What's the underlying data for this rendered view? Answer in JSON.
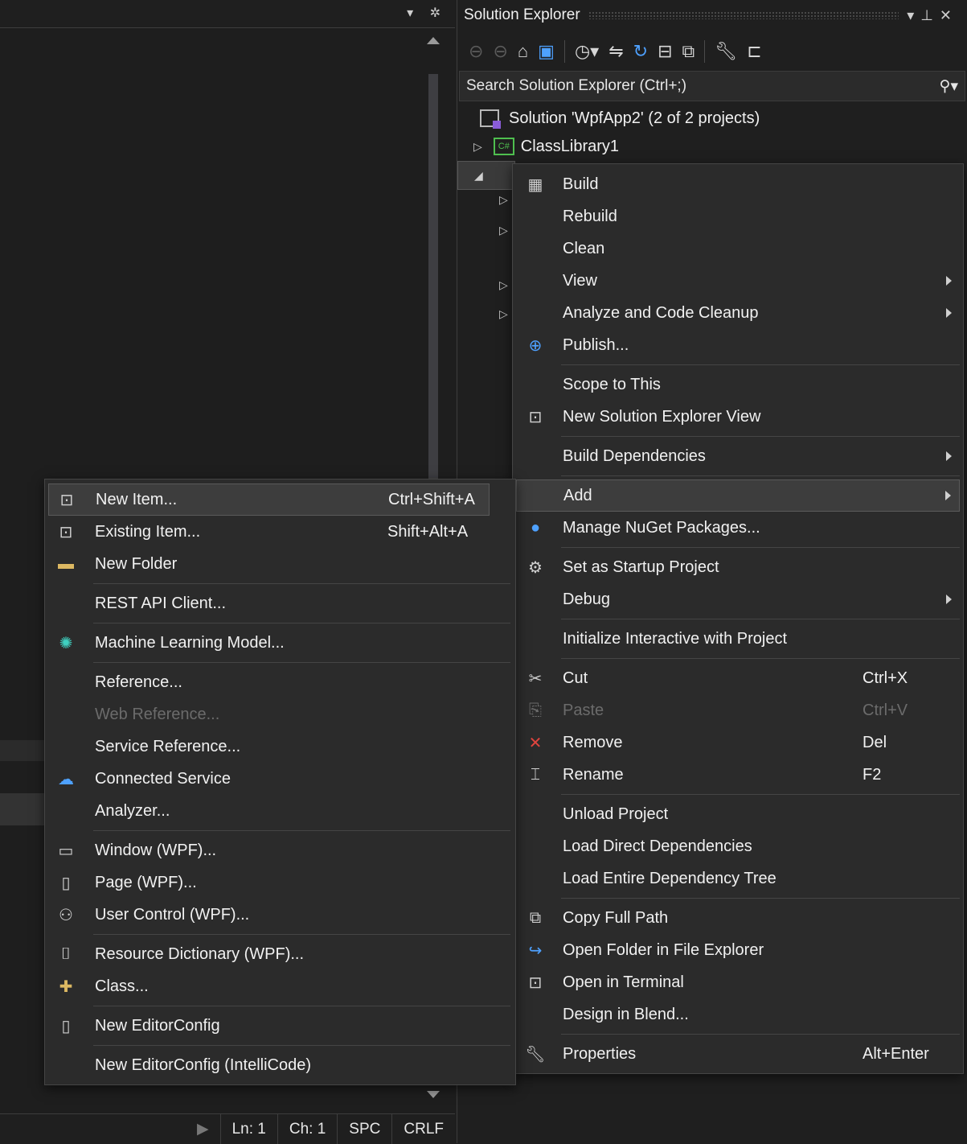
{
  "editor": {
    "status": {
      "line": "Ln: 1",
      "col": "Ch: 1",
      "indent": "SPC",
      "eol": "CRLF"
    }
  },
  "solution_explorer": {
    "title": "Solution Explorer",
    "search_placeholder": "Search Solution Explorer (Ctrl+;)",
    "solution_label": "Solution 'WpfApp2' (2 of 2 projects)",
    "project1_label": "ClassLibrary1",
    "project1_badge": "C#"
  },
  "context_menu": {
    "items": [
      {
        "label": "Build",
        "icon": "build-icon"
      },
      {
        "label": "Rebuild"
      },
      {
        "label": "Clean"
      },
      {
        "label": "View"
      },
      {
        "label": "Analyze and Code Cleanup"
      },
      {
        "label": "Publish...",
        "icon": "globe-icon"
      },
      {
        "label": "Scope to This"
      },
      {
        "label": "New Solution Explorer View",
        "icon": "new-view-icon"
      },
      {
        "label": "Build Dependencies"
      },
      {
        "label": "Add"
      },
      {
        "label": "Manage NuGet Packages...",
        "icon": "nuget-icon"
      },
      {
        "label": "Set as Startup Project",
        "icon": "gear-icon"
      },
      {
        "label": "Debug"
      },
      {
        "label": "Initialize Interactive with Project"
      },
      {
        "label": "Cut",
        "shortcut": "Ctrl+X",
        "icon": "scissors-icon"
      },
      {
        "label": "Paste",
        "shortcut": "Ctrl+V",
        "icon": "paste-icon"
      },
      {
        "label": "Remove",
        "shortcut": "Del",
        "icon": "remove-icon"
      },
      {
        "label": "Rename",
        "shortcut": "F2",
        "icon": "rename-icon"
      },
      {
        "label": "Unload Project"
      },
      {
        "label": "Load Direct Dependencies"
      },
      {
        "label": "Load Entire Dependency Tree"
      },
      {
        "label": "Copy Full Path",
        "icon": "copy-icon"
      },
      {
        "label": "Open Folder in File Explorer",
        "icon": "open-folder-icon"
      },
      {
        "label": "Open in Terminal",
        "icon": "terminal-icon"
      },
      {
        "label": "Design in Blend..."
      },
      {
        "label": "Properties",
        "shortcut": "Alt+Enter",
        "icon": "wrench-icon"
      }
    ]
  },
  "add_submenu": {
    "items": [
      {
        "label": "New Item...",
        "shortcut": "Ctrl+Shift+A",
        "icon": "new-item-icon"
      },
      {
        "label": "Existing Item...",
        "shortcut": "Shift+Alt+A",
        "icon": "existing-item-icon"
      },
      {
        "label": "New Folder",
        "icon": "new-folder-icon"
      },
      {
        "label": "REST API Client..."
      },
      {
        "label": "Machine Learning Model...",
        "icon": "ml-model-icon"
      },
      {
        "label": "Reference..."
      },
      {
        "label": "Web Reference..."
      },
      {
        "label": "Service Reference..."
      },
      {
        "label": "Connected Service",
        "icon": "connected-service-icon"
      },
      {
        "label": "Analyzer..."
      },
      {
        "label": "Window (WPF)...",
        "icon": "wpf-window-icon"
      },
      {
        "label": "Page (WPF)...",
        "icon": "wpf-page-icon"
      },
      {
        "label": "User Control (WPF)...",
        "icon": "user-control-icon"
      },
      {
        "label": "Resource Dictionary (WPF)...",
        "icon": "resource-dictionary-icon"
      },
      {
        "label": "Class...",
        "icon": "class-icon"
      },
      {
        "label": "New EditorConfig",
        "icon": "document-icon"
      },
      {
        "label": "New EditorConfig (IntelliCode)"
      }
    ]
  },
  "colors": {
    "menu_bg": "#2b2b2b",
    "accent": "#4ea1ff",
    "disabled": "#6b6b6b"
  }
}
